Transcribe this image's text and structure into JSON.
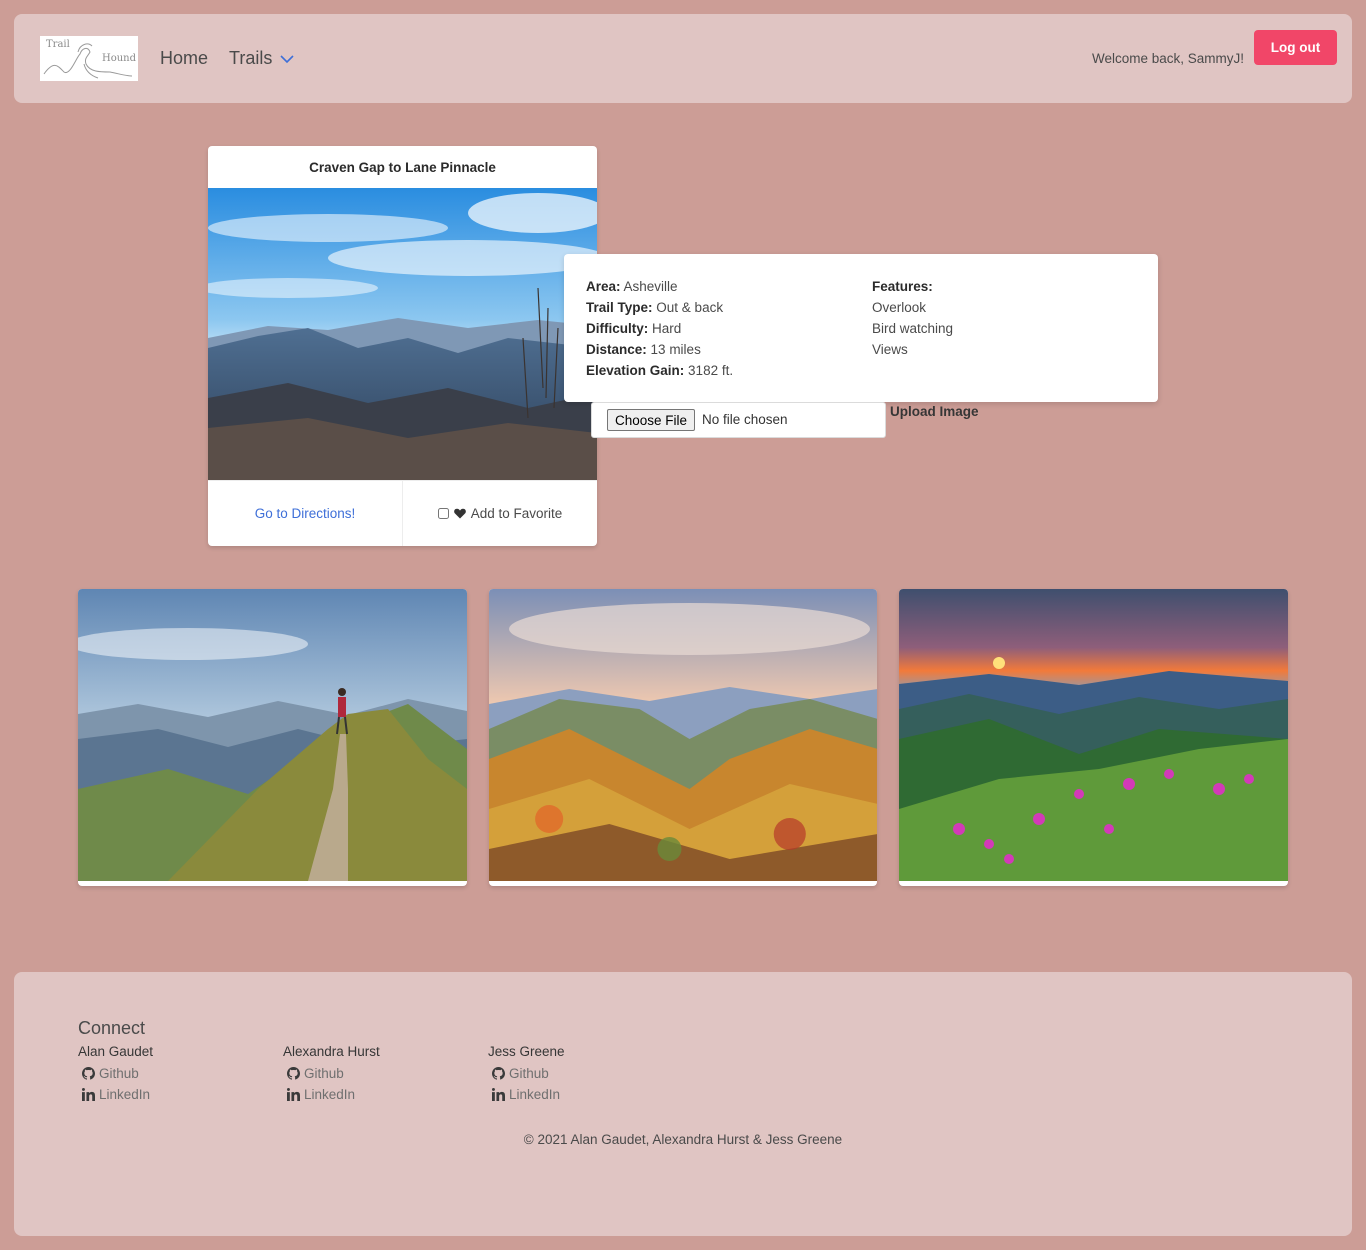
{
  "navbar": {
    "logo": {
      "line1": "Trail",
      "line2": "Hound"
    },
    "home_label": "Home",
    "trails_label": "Trails",
    "welcome_text": "Welcome back, SammyJ!",
    "logout_label": "Log out",
    "logout_color": "#f14668"
  },
  "trail": {
    "title": "Craven Gap to Lane Pinnacle",
    "directions_label": "Go to Directions!",
    "favorite_label": "Add to Favorite"
  },
  "details": {
    "area_label": "Area:",
    "area": "Asheville",
    "type_label": "Trail Type:",
    "type": "Out & back",
    "difficulty_label": "Difficulty:",
    "difficulty": "Hard",
    "distance_label": "Distance:",
    "distance": "13 miles",
    "elevation_label": "Elevation Gain:",
    "elevation": "3182 ft.",
    "features_label": "Features:",
    "features": [
      "Overlook",
      "Bird watching",
      "Views"
    ]
  },
  "upload": {
    "choose_label": "Choose File",
    "no_file": "No file chosen",
    "upload_label": "Upload Image"
  },
  "footer": {
    "connect": "Connect",
    "people": [
      {
        "name": "Alan Gaudet",
        "github": "Github",
        "linkedin": "LinkedIn"
      },
      {
        "name": "Alexandra Hurst",
        "github": "Github",
        "linkedin": "LinkedIn"
      },
      {
        "name": "Jess Greene",
        "github": "Github",
        "linkedin": "LinkedIn"
      }
    ],
    "copyright": "© 2021 Alan Gaudet, Alexandra Hurst & Jess Greene"
  },
  "colors": {
    "background": "#cc9d96",
    "panel": "#e0c5c3",
    "link": "#3e6fd8"
  }
}
